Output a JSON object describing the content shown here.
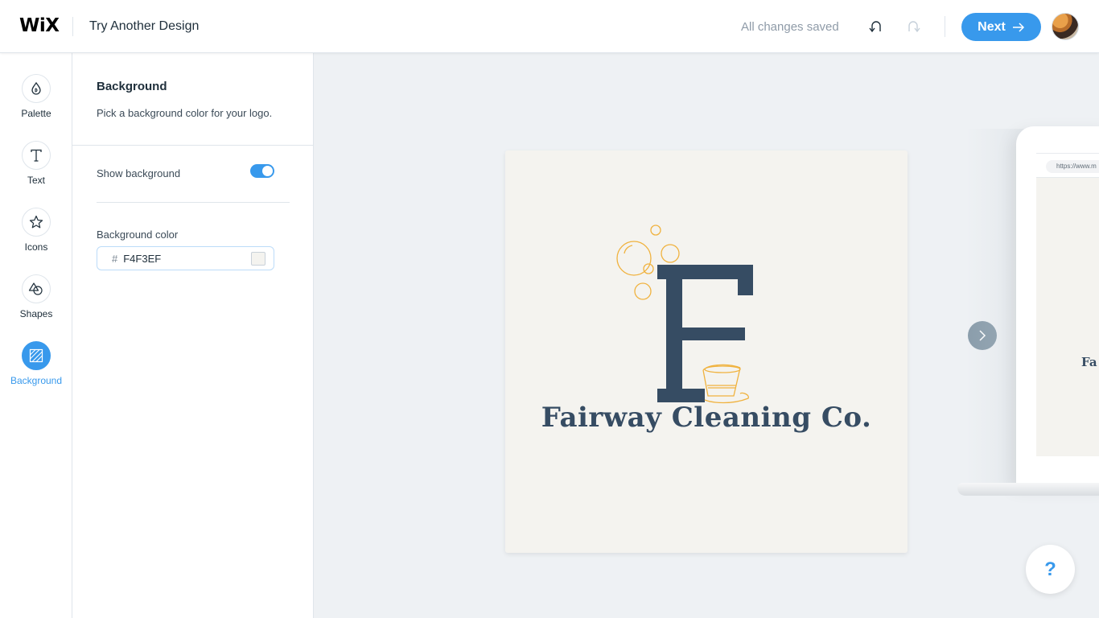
{
  "header": {
    "logo": "WiX",
    "try_another": "Try Another Design",
    "saved_status": "All changes saved",
    "undo_icon": "undo-icon",
    "redo_icon": "redo-icon",
    "next_label": "Next",
    "next_icon": "arrow-right-icon",
    "accent_color": "#3899ec"
  },
  "rail": {
    "items": [
      {
        "label": "Palette",
        "icon": "droplet-icon",
        "active": false
      },
      {
        "label": "Text",
        "icon": "text-icon",
        "active": false
      },
      {
        "label": "Icons",
        "icon": "star-icon",
        "active": false
      },
      {
        "label": "Shapes",
        "icon": "shapes-icon",
        "active": false
      },
      {
        "label": "Background",
        "icon": "background-icon",
        "active": true
      }
    ]
  },
  "panel": {
    "title": "Background",
    "description": "Pick a background color for your logo.",
    "show_background_label": "Show background",
    "show_background": true,
    "background_color_label": "Background color",
    "hash": "#",
    "background_color_value": "F4F3EF",
    "swatch_color": "#F4F3EF"
  },
  "canvas": {
    "brand_name": "Fairway Cleaning Co.",
    "monogram": "F",
    "logo_primary_color": "#364C63",
    "logo_accent_color": "#F0B23E",
    "background_color": "#F4F3EF"
  },
  "preview": {
    "url": "https://www.m",
    "brand_partial": "Fa"
  },
  "help": {
    "label": "?"
  }
}
